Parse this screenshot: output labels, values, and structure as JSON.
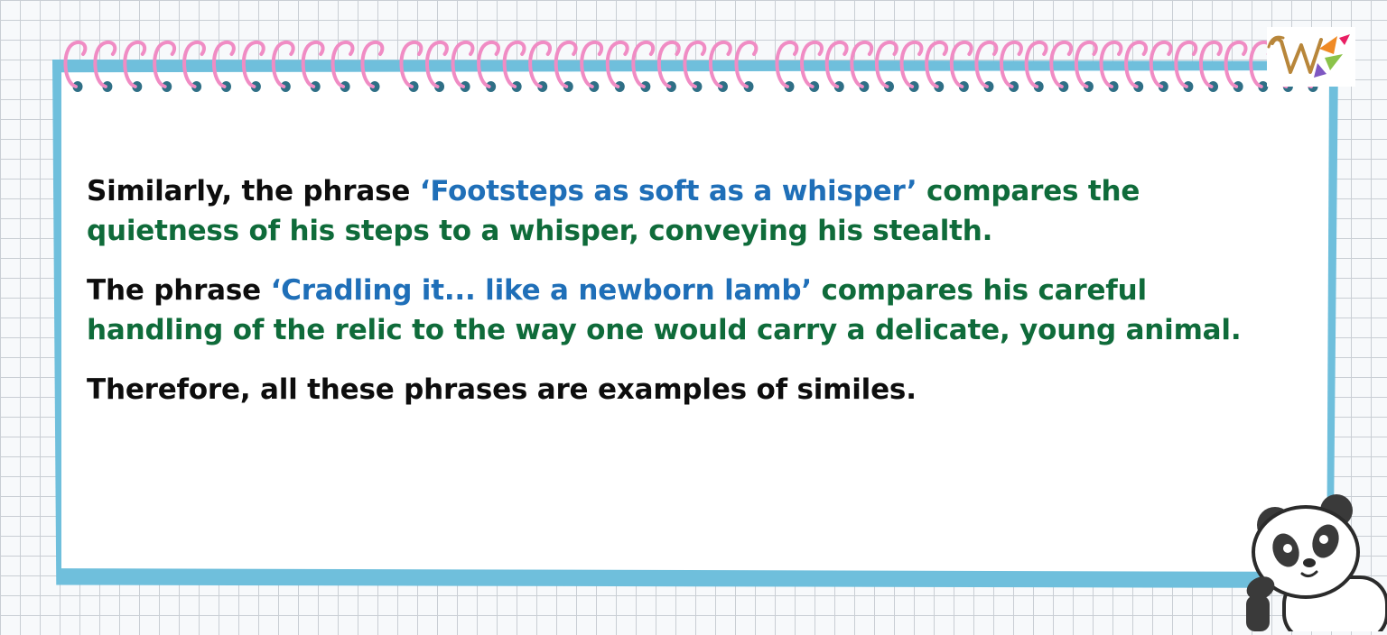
{
  "paragraphs": [
    {
      "lead": "Similarly, the phrase ",
      "quote": "‘Footsteps as soft as a whisper’",
      "rest": " compares the quietness of his steps to a whisper, conveying his stealth."
    },
    {
      "lead": "The phrase ",
      "quote": "‘Cradling it... like a newborn lamb’",
      "rest": " compares his careful handling of the relic to the way one would carry a delicate, young animal."
    },
    {
      "text": "Therefore, all these phrases are examples of similes."
    }
  ],
  "colors": {
    "frame": "#6fbfdc",
    "spiral_ring": "#f08cc4",
    "spiral_hole": "#2f6f86",
    "quote": "#1f6fb8",
    "explanation": "#0f6b3a",
    "body_text": "#0d0d0d"
  },
  "icons": {
    "logo": "brand-logo-icon",
    "mascot": "panda-mascot-icon"
  }
}
